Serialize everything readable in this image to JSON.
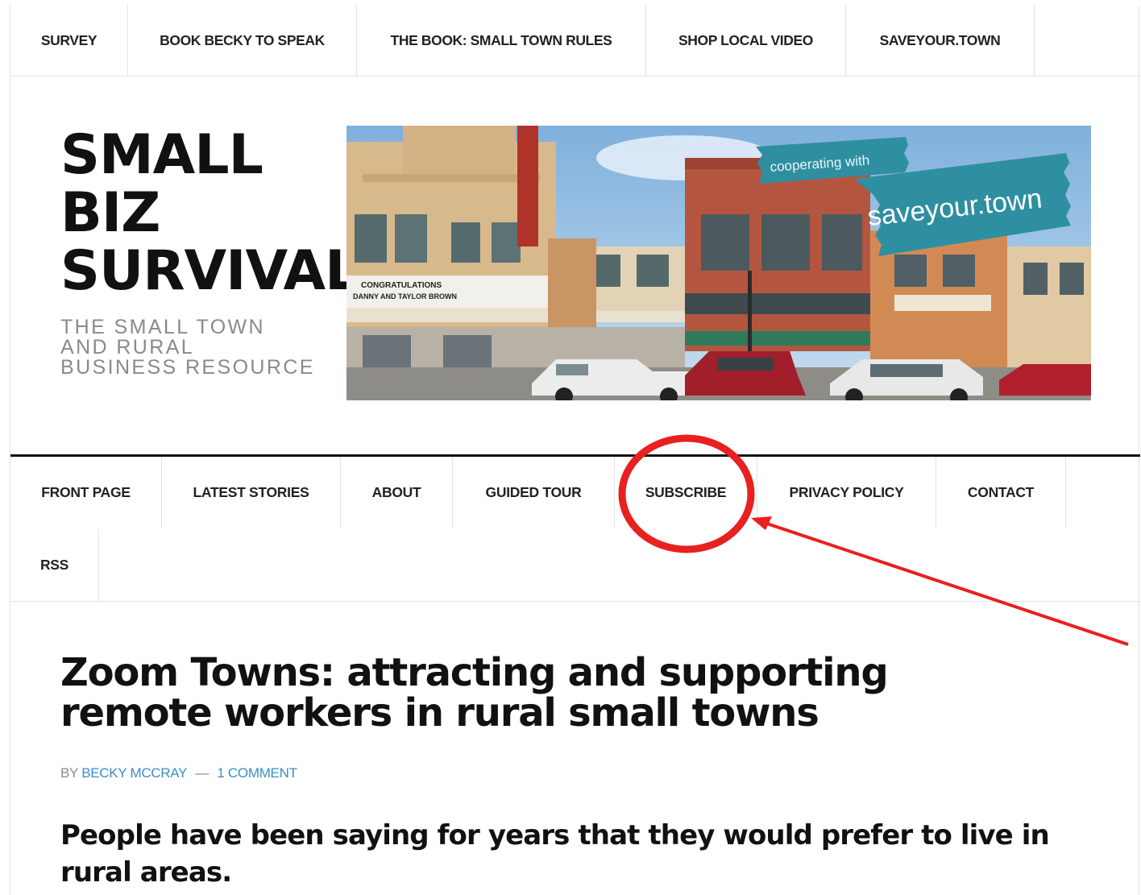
{
  "top_nav": {
    "items": [
      {
        "label": "SURVEY"
      },
      {
        "label": "BOOK BECKY TO SPEAK"
      },
      {
        "label": "THE BOOK: SMALL TOWN RULES"
      },
      {
        "label": "SHOP LOCAL VIDEO"
      },
      {
        "label": "SAVEYOUR.TOWN"
      }
    ]
  },
  "header": {
    "title_lines": [
      "SMALL",
      "BIZ",
      "SURVIVAL"
    ],
    "tagline_lines": [
      "THE SMALL TOWN",
      "AND RURAL",
      "BUSINESS RESOURCE"
    ]
  },
  "banner": {
    "ribbon_top": "cooperating with",
    "ribbon_bottom": "saveyour.town",
    "marquee_line1": "CONGRATULATIONS",
    "marquee_line2": "DANNY AND TAYLOR BROWN"
  },
  "main_nav": {
    "items": [
      {
        "label": "FRONT PAGE"
      },
      {
        "label": "LATEST STORIES"
      },
      {
        "label": "ABOUT"
      },
      {
        "label": "GUIDED TOUR"
      },
      {
        "label": "SUBSCRIBE"
      },
      {
        "label": "PRIVACY POLICY"
      },
      {
        "label": "CONTACT"
      },
      {
        "label": "RSS"
      }
    ]
  },
  "post": {
    "title_lines": [
      "Zoom Towns: attracting and supporting",
      "remote workers in rural small towns"
    ],
    "by": "BY",
    "author": "BECKY MCCRAY",
    "separator": "—",
    "comments": "1 COMMENT",
    "lede": "People have been saying for years that they would prefer to live in rural areas."
  },
  "annotation": {
    "color": "#e8201f",
    "target": "SUBSCRIBE"
  }
}
